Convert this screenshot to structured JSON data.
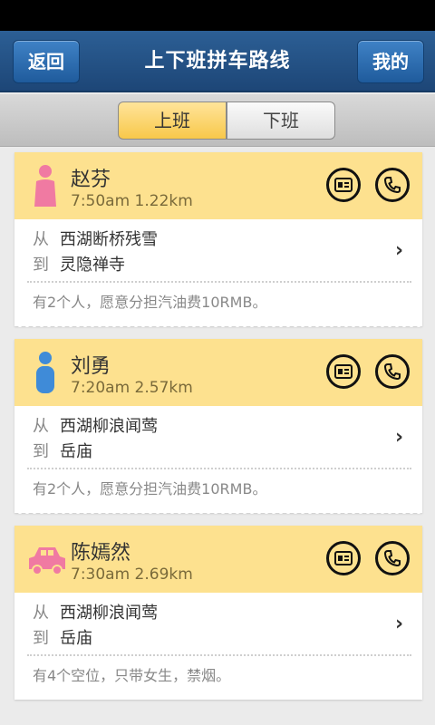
{
  "nav": {
    "back_label": "返回",
    "title": "上下班拼车路线",
    "mine_label": "我的"
  },
  "segment": {
    "active": "上班",
    "inactive": "下班"
  },
  "colors": {
    "header_blue": "#1d4677",
    "card_head": "#fde18f",
    "female_avatar": "#f07aa2",
    "male_avatar": "#3f8bd8",
    "car_avatar": "#f07aa2"
  },
  "rides": [
    {
      "avatar": "female-person-icon",
      "name": "赵芬",
      "meta": "7:50am   1.22km",
      "from_label": "从",
      "from": "西湖断桥残雪",
      "to_label": "到",
      "to": "灵隐禅寺",
      "note": "有2个人，愿意分担汽油费10RMB。"
    },
    {
      "avatar": "male-person-icon",
      "name": "刘勇",
      "meta": "7:20am   2.57km",
      "from_label": "从",
      "from": "西湖柳浪闻莺",
      "to_label": "到",
      "to": "岳庙",
      "note": "有2个人，愿意分担汽油费10RMB。"
    },
    {
      "avatar": "car-icon",
      "name": "陈嫣然",
      "meta": "7:30am   2.69km",
      "from_label": "从",
      "from": "西湖柳浪闻莺",
      "to_label": "到",
      "to": "岳庙",
      "note": "有4个空位，只带女生，禁烟。"
    }
  ]
}
